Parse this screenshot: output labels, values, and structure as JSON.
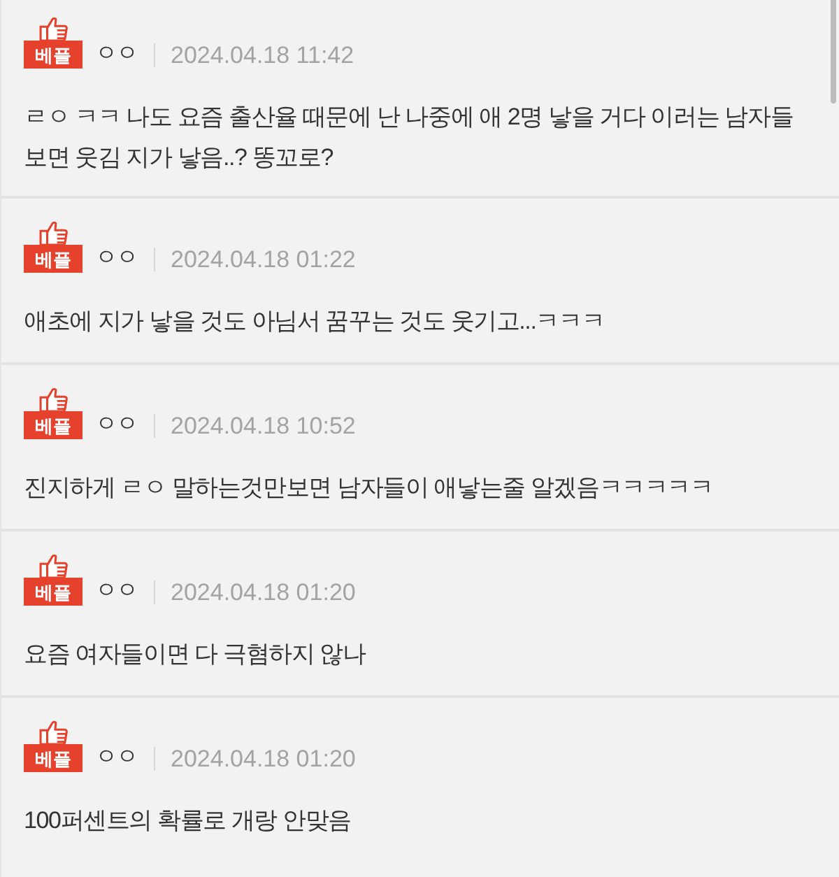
{
  "comments": [
    {
      "badge": "베플",
      "author": "ㅇㅇ",
      "date": "2024.04.18 11:42",
      "text": "ㄹㅇ ㅋㅋ 나도 요즘 출산율 때문에 난 나중에 애 2명 낳을 거다 이러는 남자들 보면 웃김 지가 낳음..? 똥꼬로?"
    },
    {
      "badge": "베플",
      "author": "ㅇㅇ",
      "date": "2024.04.18 01:22",
      "text": "애초에 지가 낳을 것도 아님서 꿈꾸는 것도 웃기고...ㅋㅋㅋ"
    },
    {
      "badge": "베플",
      "author": "ㅇㅇ",
      "date": "2024.04.18 10:52",
      "text": "진지하게 ㄹㅇ 말하는것만보면 남자들이 애낳는줄 알겠음ㅋㅋㅋㅋㅋ"
    },
    {
      "badge": "베플",
      "author": "ㅇㅇ",
      "date": "2024.04.18 01:20",
      "text": "요즘 여자들이면 다 극혐하지 않나"
    },
    {
      "badge": "베플",
      "author": "ㅇㅇ",
      "date": "2024.04.18 01:20",
      "text": "100퍼센트의 확률로 개랑 안맞음"
    }
  ]
}
